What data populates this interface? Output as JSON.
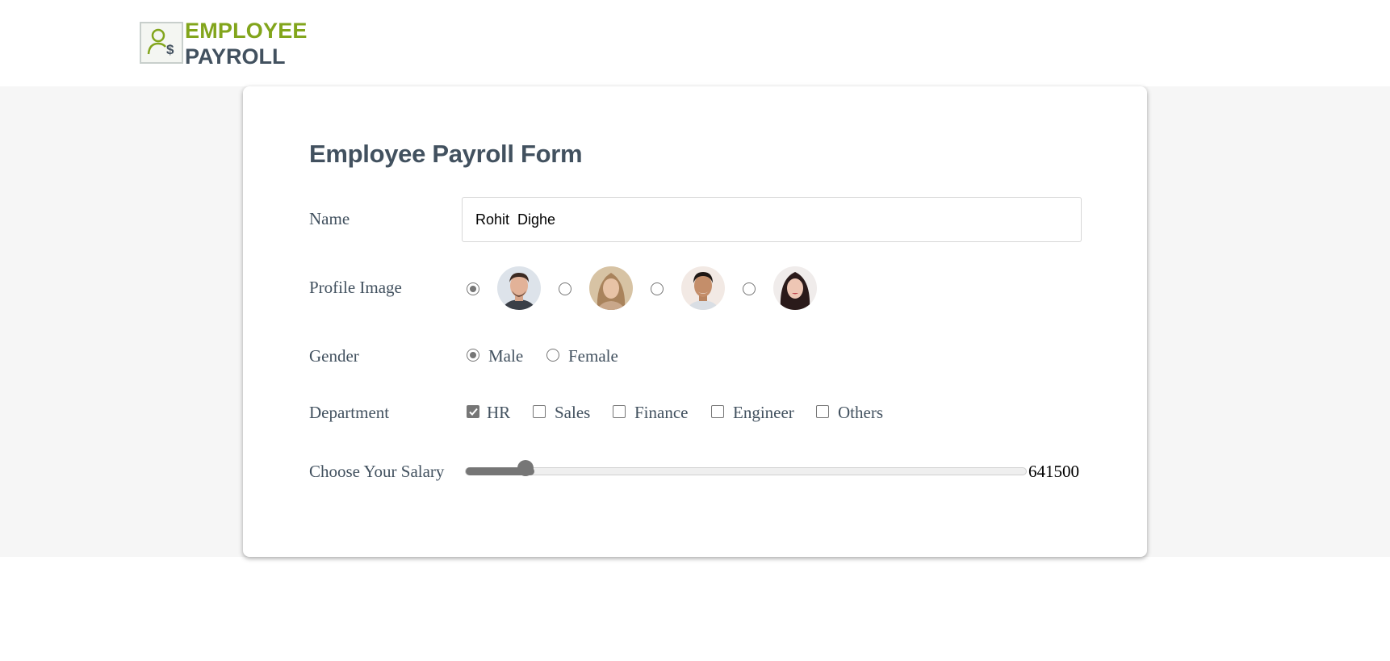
{
  "logo": {
    "line1": "EMPLOYEE",
    "line2": "PAYROLL",
    "icon": "user-dollar-icon",
    "accent": "#82a51c",
    "dark": "#42515f"
  },
  "form": {
    "title": "Employee Payroll Form",
    "name": {
      "label": "Name",
      "value": "Rohit  Dighe"
    },
    "profile_image": {
      "label": "Profile Image",
      "options": [
        {
          "avatar": "man-avatar-1",
          "selected": true
        },
        {
          "avatar": "woman-avatar-1",
          "selected": false
        },
        {
          "avatar": "man-avatar-2",
          "selected": false
        },
        {
          "avatar": "woman-avatar-2",
          "selected": false
        }
      ]
    },
    "gender": {
      "label": "Gender",
      "options": [
        {
          "label": "Male",
          "selected": true
        },
        {
          "label": "Female",
          "selected": false
        }
      ]
    },
    "department": {
      "label": "Department",
      "options": [
        {
          "label": "HR",
          "checked": true
        },
        {
          "label": "Sales",
          "checked": false
        },
        {
          "label": "Finance",
          "checked": false
        },
        {
          "label": "Engineer",
          "checked": false
        },
        {
          "label": "Others",
          "checked": false
        }
      ]
    },
    "salary": {
      "label": "Choose Your Salary",
      "value": "641500",
      "fill_fraction": 0.108
    }
  }
}
